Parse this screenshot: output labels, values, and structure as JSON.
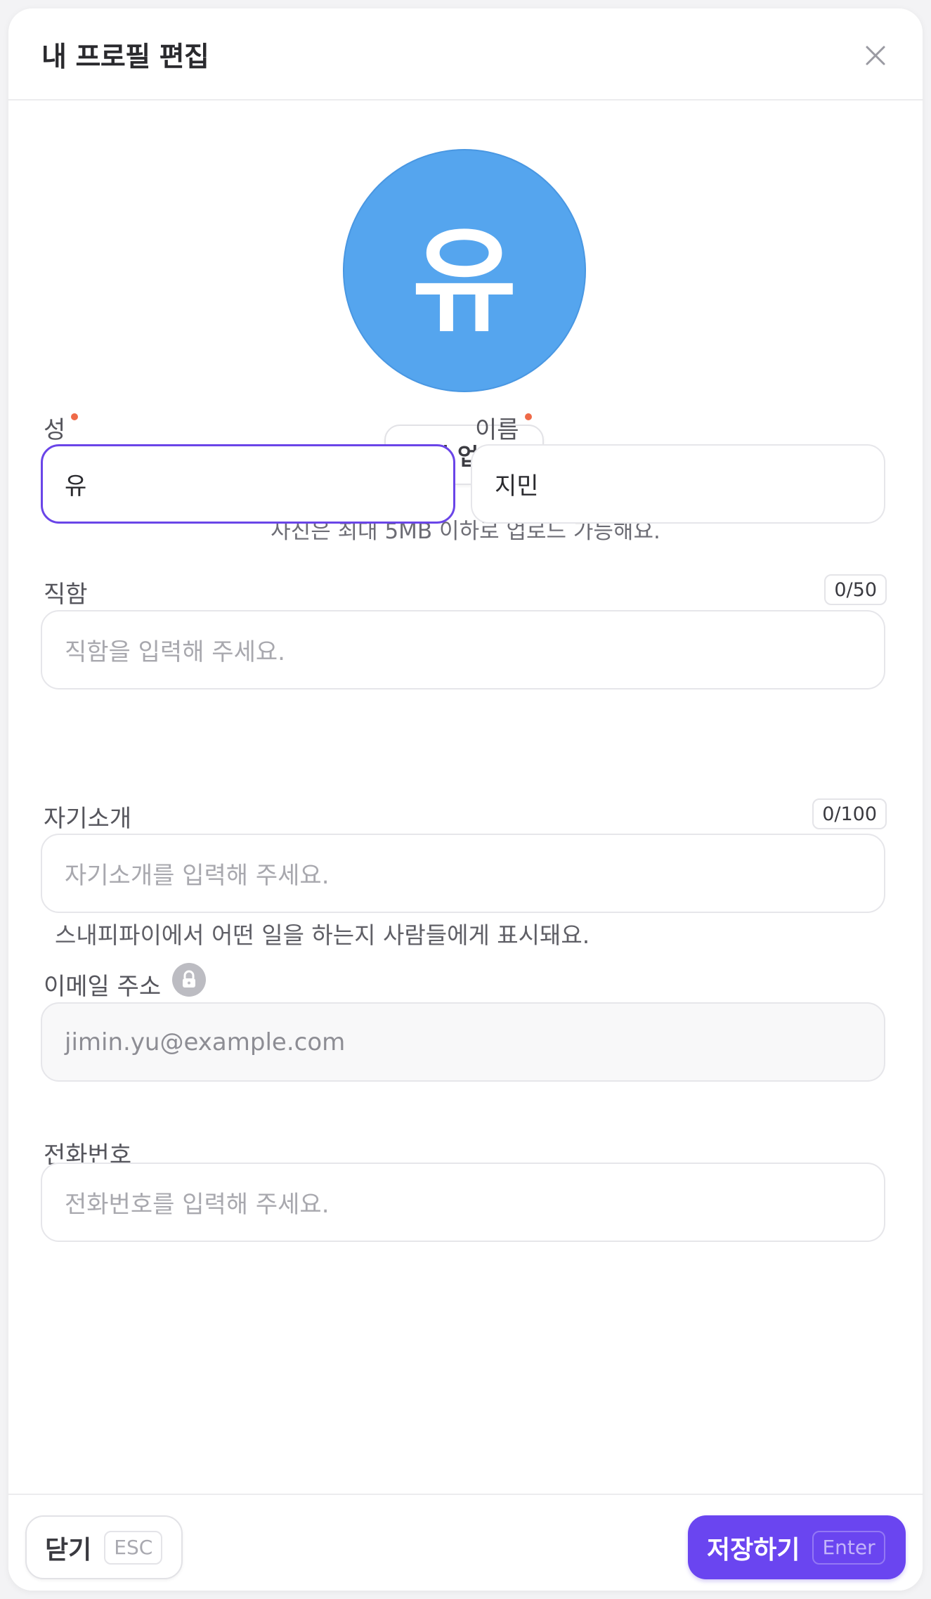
{
  "header": {
    "title": "내 프로필 편집",
    "close_icon": "close-icon"
  },
  "avatar": {
    "initial": "유",
    "color": "#55a5ee"
  },
  "upload": {
    "button_label": "사진 업로드",
    "hint": "사진은 최대 5MB 이하로 업로드 가능해요."
  },
  "fields": {
    "last_name": {
      "label": "성",
      "value": "유",
      "required": true
    },
    "first_name": {
      "label": "이름",
      "value": "지민",
      "required": true
    },
    "job_title": {
      "label": "직함",
      "counter": "0/50",
      "placeholder": "직함을 입력해 주세요.",
      "helper": "스내피파이에서 어떤 일을 하는지 사람들에게 표시돼요."
    },
    "bio": {
      "label": "자기소개",
      "counter": "0/100",
      "placeholder": "자기소개를 입력해 주세요."
    },
    "email": {
      "label": "이메일 주소",
      "value": "jimin.yu@example.com",
      "icon": "lock-icon"
    },
    "phone": {
      "label": "전화번호",
      "placeholder": "전화번호를 입력해 주세요."
    }
  },
  "footer": {
    "close_label": "닫기",
    "close_shortcut": "ESC",
    "save_label": "저장하기",
    "save_shortcut": "Enter"
  },
  "colors": {
    "accent": "#6a45f0",
    "required_dot": "#ef6a48"
  }
}
